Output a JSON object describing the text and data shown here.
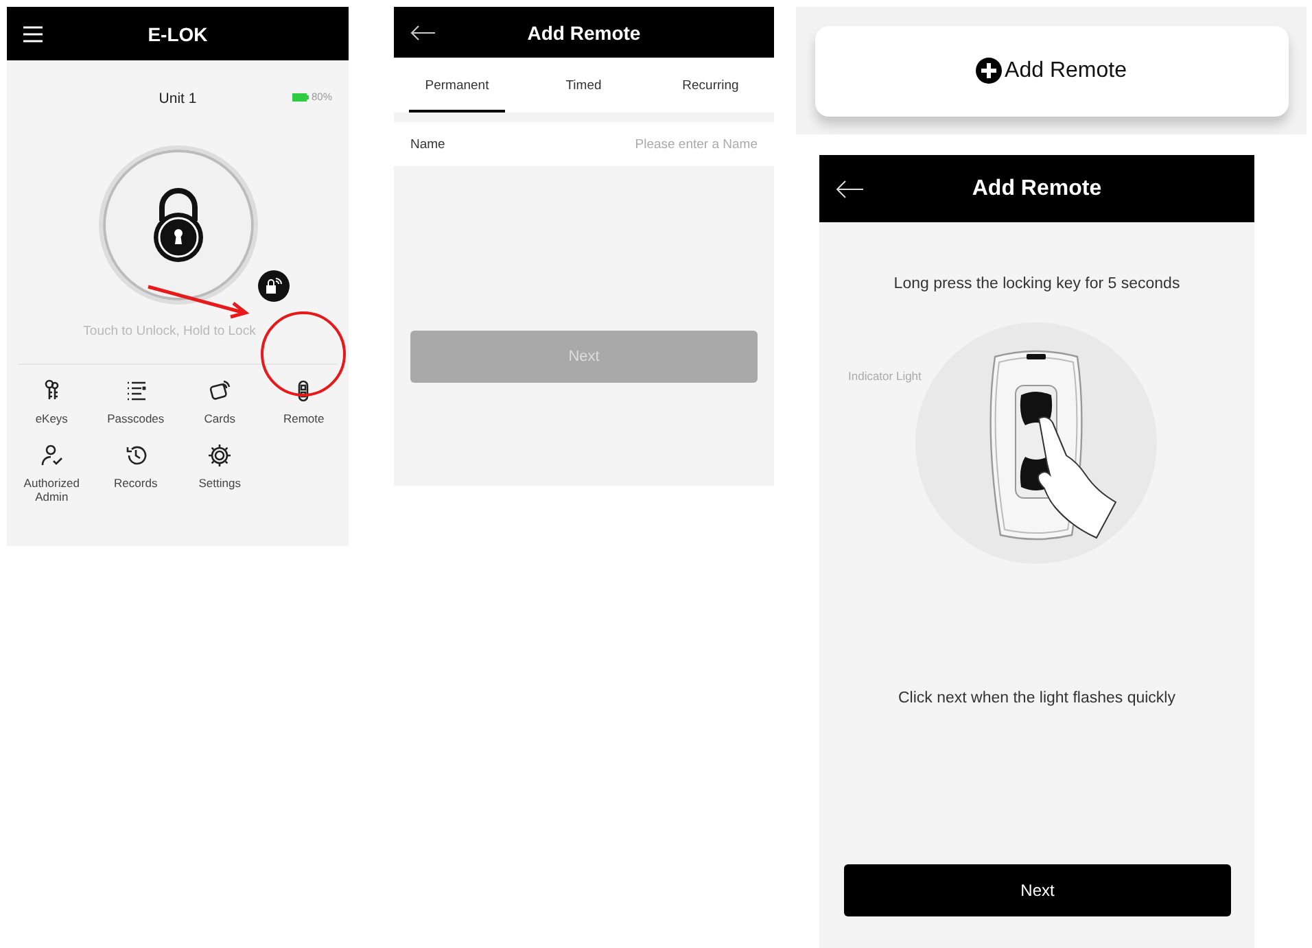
{
  "lock_screen": {
    "title": "E-LOK",
    "unit": "Unit 1",
    "battery": "80%",
    "hint": "Touch to Unlock, Hold to Lock",
    "features": [
      {
        "kind": "ekeys",
        "label": "eKeys"
      },
      {
        "kind": "passcodes",
        "label": "Passcodes"
      },
      {
        "kind": "cards",
        "label": "Cards"
      },
      {
        "kind": "remote",
        "label": "Remote"
      },
      {
        "kind": "admin",
        "label": "Authorized Admin"
      },
      {
        "kind": "records",
        "label": "Records"
      },
      {
        "kind": "settings",
        "label": "Settings"
      }
    ]
  },
  "add_remote_form": {
    "title": "Add Remote",
    "tabs": [
      {
        "label": "Permanent",
        "selected": true
      },
      {
        "label": "Timed",
        "selected": false
      },
      {
        "label": "Recurring",
        "selected": false
      }
    ],
    "name_field": {
      "label": "Name",
      "placeholder": "Please enter a Name"
    },
    "next_button": {
      "label": "Next",
      "disabled": true
    }
  },
  "add_remote_button": {
    "label": "Add Remote"
  },
  "pairing_screen": {
    "title": "Add Remote",
    "instruction": "Long press the locking key for 5 seconds",
    "indicator_label": "Indicator Light",
    "confirm_text": "Click next when the light flashes quickly",
    "next_button": {
      "label": "Next",
      "disabled": false
    }
  }
}
